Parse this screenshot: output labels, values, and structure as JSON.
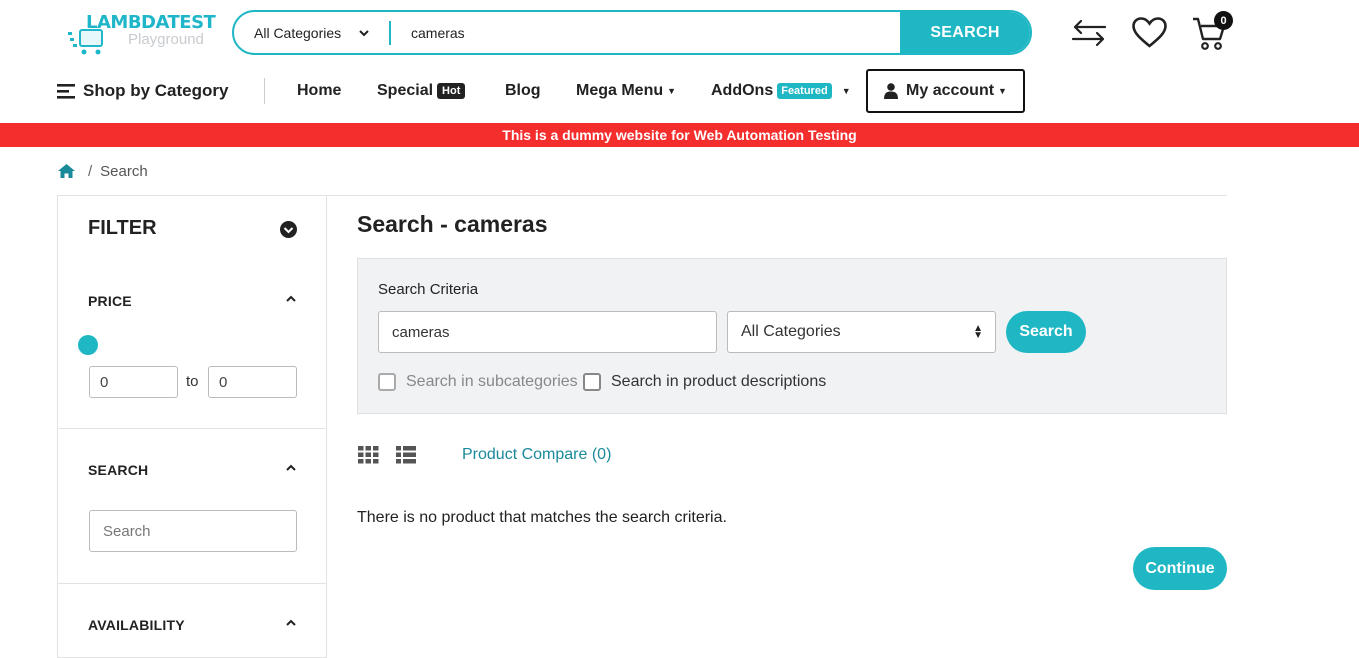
{
  "header": {
    "logo_text": "LAMBDATEST",
    "logo_subtext": "Playground",
    "search_category": "All Categories",
    "search_value": "cameras",
    "search_button": "SEARCH",
    "cart_count": "0"
  },
  "nav": {
    "shop_by_category": "Shop by Category",
    "items": [
      {
        "label": "Home"
      },
      {
        "label": "Special",
        "badge": "Hot"
      },
      {
        "label": "Blog"
      },
      {
        "label": "Mega Menu"
      },
      {
        "label": "AddOns",
        "badge": "Featured"
      }
    ],
    "my_account": "My account"
  },
  "banner": "This is a dummy website for Web Automation Testing",
  "breadcrumb": {
    "current": "Search"
  },
  "sidebar": {
    "title": "FILTER",
    "price": {
      "heading": "PRICE",
      "min": "0",
      "to_label": "to",
      "max": "0"
    },
    "search": {
      "heading": "SEARCH",
      "placeholder": "Search"
    },
    "availability": {
      "heading": "AVAILABILITY"
    }
  },
  "main": {
    "title": "Search - cameras",
    "criteria": {
      "label": "Search Criteria",
      "keyword": "cameras",
      "category": "All Categories",
      "search_button": "Search",
      "subcategories_label": "Search in subcategories",
      "descriptions_label": "Search in product descriptions"
    },
    "compare_link": "Product Compare (0)",
    "no_results": "There is no product that matches the search criteria.",
    "continue_button": "Continue"
  },
  "colors": {
    "accent": "#20b7c5",
    "banner": "#f42d2d",
    "link": "#1a8a9b"
  }
}
